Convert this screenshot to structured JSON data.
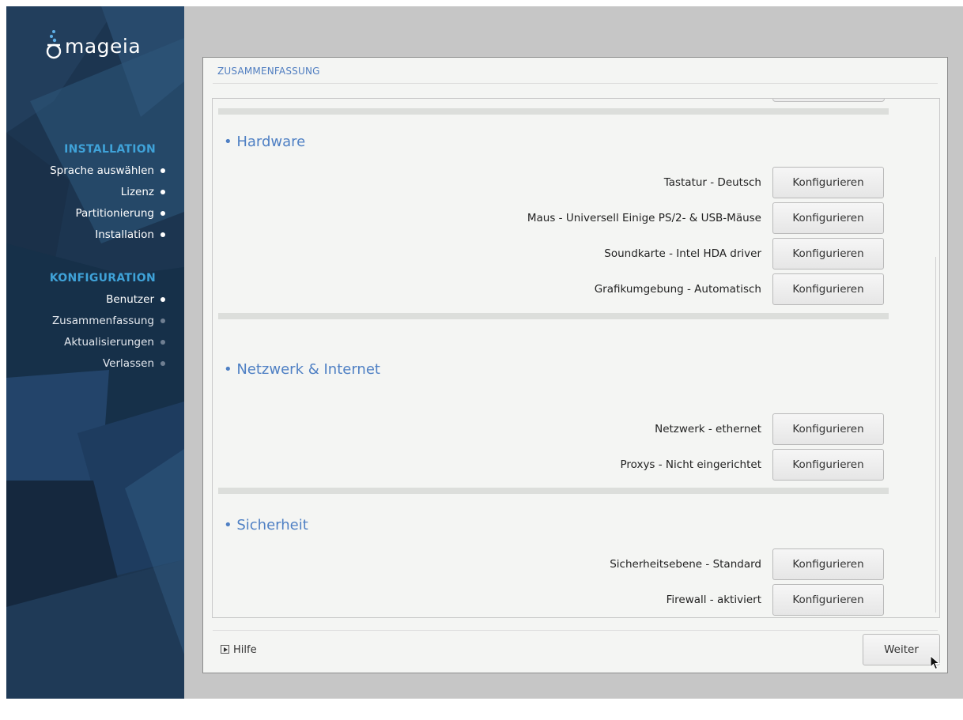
{
  "sidebar": {
    "logo_text": "mageia",
    "sections": [
      {
        "title": "INSTALLATION",
        "items": [
          {
            "label": "Sprache auswählen",
            "state": "done"
          },
          {
            "label": "Lizenz",
            "state": "done"
          },
          {
            "label": "Partitionierung",
            "state": "done"
          },
          {
            "label": "Installation",
            "state": "done"
          }
        ]
      },
      {
        "title": "KONFIGURATION",
        "items": [
          {
            "label": "Benutzer",
            "state": "done"
          },
          {
            "label": "Zusammenfassung",
            "state": "pending"
          },
          {
            "label": "Aktualisierungen",
            "state": "pending"
          },
          {
            "label": "Verlassen",
            "state": "pending"
          }
        ]
      }
    ]
  },
  "dialog": {
    "title": "ZUSAMMENFASSUNG",
    "sections": [
      {
        "title": "• Hardware",
        "rows": [
          {
            "label": "Tastatur - Deutsch",
            "button": "Konfigurieren"
          },
          {
            "label": "Maus - Universell Einige PS/2- & USB-Mäuse",
            "button": "Konfigurieren"
          },
          {
            "label": "Soundkarte - Intel HDA driver",
            "button": "Konfigurieren"
          },
          {
            "label": "Grafikumgebung - Automatisch",
            "button": "Konfigurieren"
          }
        ]
      },
      {
        "title": "• Netzwerk & Internet",
        "rows": [
          {
            "label": "Netzwerk - ethernet",
            "button": "Konfigurieren"
          },
          {
            "label": "Proxys - Nicht eingerichtet",
            "button": "Konfigurieren"
          }
        ]
      },
      {
        "title": "• Sicherheit",
        "rows": [
          {
            "label": "Sicherheitsebene - Standard",
            "button": "Konfigurieren"
          },
          {
            "label": "Firewall - aktiviert",
            "button": "Konfigurieren"
          }
        ]
      }
    ],
    "help_label": "Hilfe",
    "next_label": "Weiter"
  },
  "colors": {
    "sidebar_bg": "#1c3550",
    "section_accent": "#3fa2d8",
    "heading_blue": "#4f80c4",
    "desktop_bg": "#c6c6c6"
  }
}
